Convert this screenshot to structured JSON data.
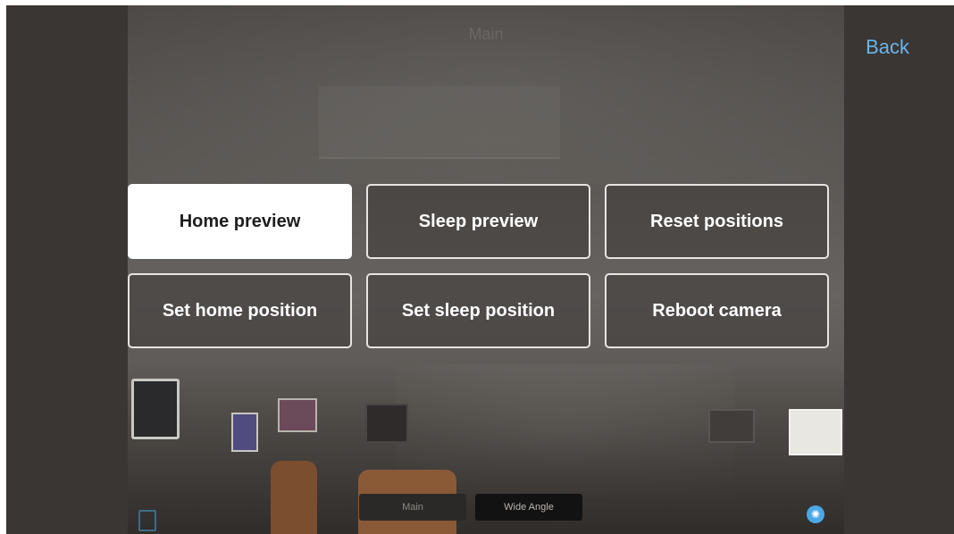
{
  "header": {
    "title": "Main",
    "back_label": "Back"
  },
  "actions": [
    {
      "label": "Home preview",
      "selected": true
    },
    {
      "label": "Sleep preview",
      "selected": false
    },
    {
      "label": "Reset positions",
      "selected": false
    },
    {
      "label": "Set home position",
      "selected": false
    },
    {
      "label": "Set sleep position",
      "selected": false
    },
    {
      "label": "Reboot camera",
      "selected": false
    }
  ],
  "view_switch": {
    "options": [
      "Main",
      "Wide Angle"
    ],
    "selected": "Wide Angle"
  },
  "icons": {
    "shutter": "camera-shutter-icon",
    "side_control": "panel-icon"
  },
  "colors": {
    "accent": "#6db4e8",
    "selected_bg": "#ffffff",
    "button_border": "#e7e5e1"
  }
}
